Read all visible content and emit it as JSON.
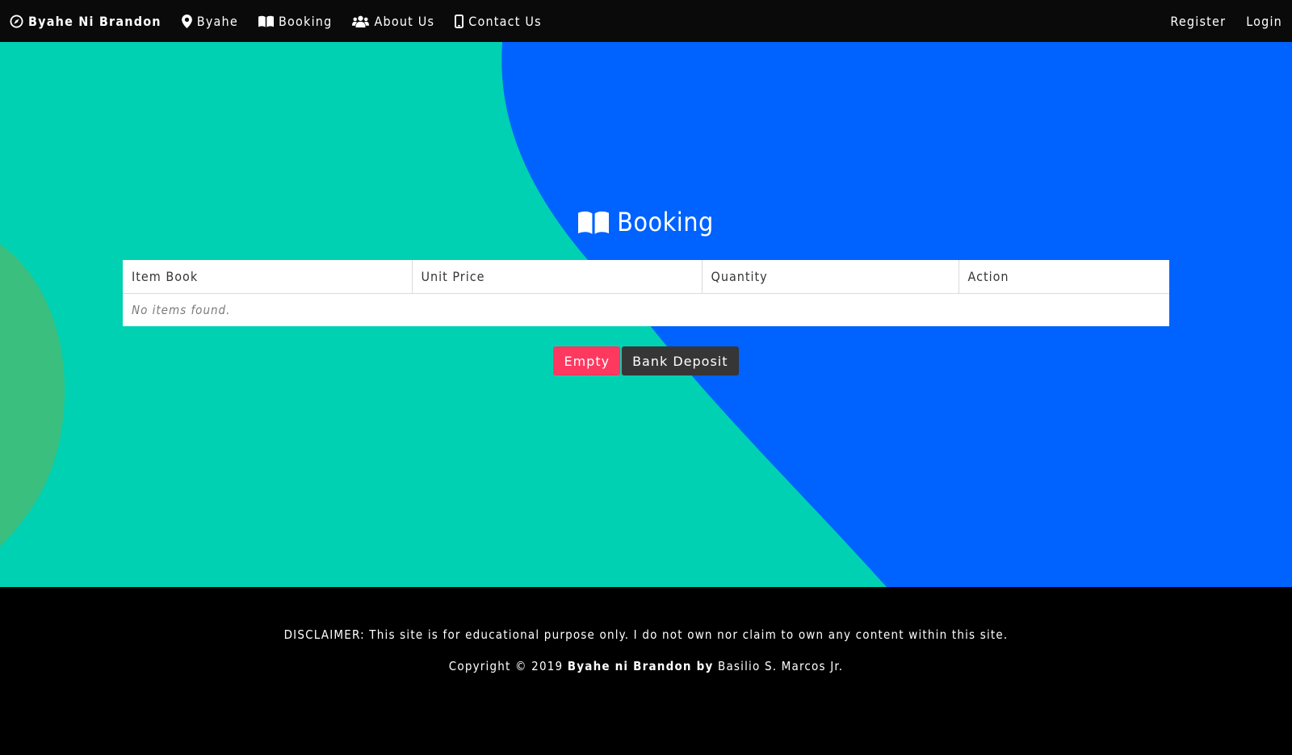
{
  "navbar": {
    "brand": "Byahe Ni Brandon",
    "items": [
      {
        "label": "Byahe",
        "icon": "map-marker-icon"
      },
      {
        "label": "Booking",
        "icon": "book-open-icon"
      },
      {
        "label": "About Us",
        "icon": "users-icon"
      },
      {
        "label": "Contact Us",
        "icon": "mobile-icon"
      }
    ],
    "right": {
      "register": "Register",
      "login": "Login"
    }
  },
  "page": {
    "title": "Booking",
    "title_icon": "book-open-icon"
  },
  "table": {
    "headers": [
      "Item Book",
      "Unit Price",
      "Quantity",
      "Action"
    ],
    "empty_message": "No items found."
  },
  "actions": {
    "empty_label": "Empty",
    "bank_deposit_label": "Bank Deposit"
  },
  "footer": {
    "disclaimer": "DISCLAIMER: This site is for educational purpose only. I do not own nor claim to own any content within this site.",
    "copyright_prefix": "Copyright © 2019 ",
    "site_name": "Byahe ni Brandon",
    "by": " by",
    "author": " Basilio S. Marcos Jr."
  },
  "colors": {
    "teal": "#00d1b2",
    "blue": "#0062ff",
    "green_blob": "#3bbf7f",
    "danger": "#ff3860",
    "dark": "#363636",
    "navbar_bg": "#0a0a0a"
  }
}
